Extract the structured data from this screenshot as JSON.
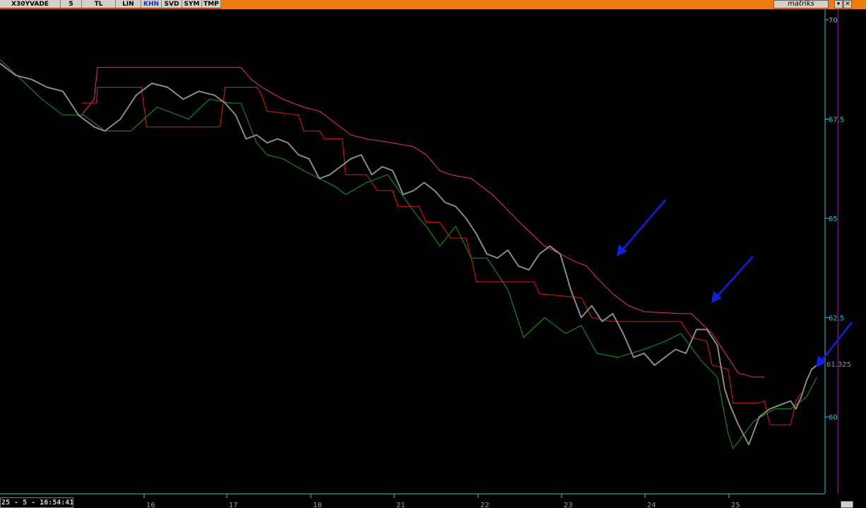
{
  "toolbar": {
    "symbol": "X30YVADE",
    "period": "5",
    "currency": "TL",
    "scale": "LIN",
    "khn": "KHN",
    "svd": "SVD",
    "sym": "SYM",
    "tmp": "TMP",
    "brand": "matriks",
    "dropdown_icon": "triangle-down",
    "close_icon": "cross"
  },
  "status": {
    "time": "25 - 5 - 16:54:41"
  },
  "colors": {
    "price": "#8a8a8a",
    "upper_band": "#e8307a",
    "middle_band": "#e01818",
    "lower_band": "#189a18",
    "cursor_line": "#a020a0",
    "arrows": "#1020e0",
    "axis": "#40c0d0"
  },
  "chart_data": {
    "type": "line",
    "title": "",
    "xlabel": "",
    "ylabel": "",
    "ylim": [
      58.0,
      70.3
    ],
    "yticks": [
      "70",
      "67.5",
      "65",
      "62.5",
      "60"
    ],
    "xticks": [
      "16",
      "17",
      "18",
      "21",
      "22",
      "23",
      "24",
      "25"
    ],
    "last_value_label": "61.325",
    "cursor_x": 23.0,
    "grid": false,
    "series": [
      {
        "key": "upper_band",
        "points": [
          [
            15.78,
            67.6
          ],
          [
            15.9,
            68.0
          ],
          [
            15.93,
            68.8
          ],
          [
            16.4,
            68.8
          ],
          [
            16.8,
            68.8
          ],
          [
            17.1,
            68.8
          ],
          [
            17.3,
            68.8
          ],
          [
            17.4,
            68.5
          ],
          [
            17.5,
            68.3
          ],
          [
            17.7,
            68.0
          ],
          [
            17.9,
            67.8
          ],
          [
            18.05,
            67.7
          ],
          [
            18.2,
            67.4
          ],
          [
            18.35,
            67.1
          ],
          [
            18.5,
            67.0
          ],
          [
            18.75,
            66.9
          ],
          [
            18.95,
            66.8
          ],
          [
            19.07,
            66.6
          ],
          [
            19.2,
            66.2
          ],
          [
            19.3,
            66.1
          ],
          [
            19.5,
            66.0
          ],
          [
            19.7,
            65.6
          ],
          [
            19.85,
            65.2
          ],
          [
            20.0,
            64.8
          ],
          [
            20.2,
            64.3
          ],
          [
            20.35,
            64.1
          ],
          [
            20.5,
            63.9
          ],
          [
            20.6,
            63.8
          ],
          [
            20.7,
            63.5
          ],
          [
            20.85,
            63.1
          ],
          [
            21.0,
            62.8
          ],
          [
            21.15,
            62.65
          ],
          [
            21.5,
            62.6
          ],
          [
            21.6,
            62.6
          ],
          [
            21.8,
            62.1
          ],
          [
            21.95,
            61.5
          ],
          [
            22.05,
            61.1
          ],
          [
            22.2,
            61.0
          ],
          [
            22.3,
            61.0
          ]
        ]
      },
      {
        "key": "middle_band",
        "points": [
          [
            15.78,
            67.9
          ],
          [
            15.92,
            67.9
          ],
          [
            15.93,
            68.3
          ],
          [
            16.25,
            68.3
          ],
          [
            16.35,
            68.3
          ],
          [
            16.4,
            67.3
          ],
          [
            16.8,
            67.3
          ],
          [
            17.1,
            67.3
          ],
          [
            17.15,
            68.3
          ],
          [
            17.45,
            68.3
          ],
          [
            17.5,
            68.1
          ],
          [
            17.55,
            67.7
          ],
          [
            17.85,
            67.6
          ],
          [
            17.9,
            67.2
          ],
          [
            18.05,
            67.2
          ],
          [
            18.1,
            67.0
          ],
          [
            18.27,
            67.0
          ],
          [
            18.3,
            66.1
          ],
          [
            18.5,
            66.1
          ],
          [
            18.6,
            65.7
          ],
          [
            18.75,
            65.7
          ],
          [
            18.8,
            65.3
          ],
          [
            19.0,
            65.3
          ],
          [
            19.07,
            64.9
          ],
          [
            19.2,
            64.9
          ],
          [
            19.3,
            64.5
          ],
          [
            19.45,
            64.5
          ],
          [
            19.5,
            64.0
          ],
          [
            19.55,
            63.4
          ],
          [
            20.1,
            63.4
          ],
          [
            20.15,
            63.1
          ],
          [
            20.55,
            63.0
          ],
          [
            20.65,
            62.5
          ],
          [
            20.85,
            62.4
          ],
          [
            21.1,
            62.4
          ],
          [
            21.5,
            62.4
          ],
          [
            21.6,
            62.0
          ],
          [
            21.75,
            61.9
          ],
          [
            21.8,
            61.3
          ],
          [
            21.95,
            61.2
          ],
          [
            22.0,
            60.35
          ],
          [
            22.25,
            60.35
          ],
          [
            22.3,
            60.4
          ],
          [
            22.35,
            59.8
          ],
          [
            22.55,
            59.8
          ],
          [
            22.6,
            60.4
          ],
          [
            22.65,
            60.6
          ]
        ]
      },
      {
        "key": "lower_band",
        "points": [
          [
            15.0,
            69.0
          ],
          [
            15.2,
            68.5
          ],
          [
            15.4,
            68.0
          ],
          [
            15.6,
            67.6
          ],
          [
            15.8,
            67.6
          ],
          [
            16.0,
            67.2
          ],
          [
            16.25,
            67.2
          ],
          [
            16.5,
            67.8
          ],
          [
            16.8,
            67.5
          ],
          [
            17.0,
            68.0
          ],
          [
            17.2,
            67.9
          ],
          [
            17.3,
            67.9
          ],
          [
            17.45,
            66.9
          ],
          [
            17.55,
            66.6
          ],
          [
            17.7,
            66.5
          ],
          [
            17.9,
            66.2
          ],
          [
            18.2,
            65.8
          ],
          [
            18.3,
            65.6
          ],
          [
            18.5,
            65.9
          ],
          [
            18.7,
            66.1
          ],
          [
            19.0,
            65.0
          ],
          [
            19.07,
            64.8
          ],
          [
            19.2,
            64.3
          ],
          [
            19.35,
            64.8
          ],
          [
            19.5,
            64.0
          ],
          [
            19.65,
            64.0
          ],
          [
            19.85,
            63.2
          ],
          [
            20.0,
            62.0
          ],
          [
            20.2,
            62.5
          ],
          [
            20.4,
            62.1
          ],
          [
            20.55,
            62.3
          ],
          [
            20.7,
            61.6
          ],
          [
            20.9,
            61.5
          ],
          [
            21.15,
            61.7
          ],
          [
            21.35,
            61.9
          ],
          [
            21.5,
            62.1
          ],
          [
            21.7,
            61.4
          ],
          [
            21.85,
            61.0
          ],
          [
            21.95,
            59.6
          ],
          [
            22.0,
            59.2
          ],
          [
            22.2,
            59.9
          ],
          [
            22.4,
            60.2
          ],
          [
            22.55,
            60.2
          ],
          [
            22.7,
            60.5
          ],
          [
            22.8,
            61.0
          ]
        ]
      },
      {
        "key": "price",
        "points": [
          [
            15.0,
            68.9
          ],
          [
            15.15,
            68.6
          ],
          [
            15.3,
            68.5
          ],
          [
            15.45,
            68.3
          ],
          [
            15.6,
            68.2
          ],
          [
            15.75,
            67.6
          ],
          [
            15.9,
            67.3
          ],
          [
            16.0,
            67.2
          ],
          [
            16.15,
            67.5
          ],
          [
            16.3,
            68.1
          ],
          [
            16.45,
            68.4
          ],
          [
            16.6,
            68.3
          ],
          [
            16.75,
            68.0
          ],
          [
            16.9,
            68.2
          ],
          [
            17.05,
            68.1
          ],
          [
            17.15,
            67.9
          ],
          [
            17.25,
            67.6
          ],
          [
            17.35,
            67.0
          ],
          [
            17.45,
            67.1
          ],
          [
            17.55,
            66.9
          ],
          [
            17.65,
            67.0
          ],
          [
            17.75,
            66.9
          ],
          [
            17.85,
            66.6
          ],
          [
            17.95,
            66.5
          ],
          [
            18.05,
            66.0
          ],
          [
            18.15,
            66.1
          ],
          [
            18.25,
            66.3
          ],
          [
            18.35,
            66.5
          ],
          [
            18.45,
            66.6
          ],
          [
            18.55,
            66.1
          ],
          [
            18.65,
            66.3
          ],
          [
            18.75,
            66.2
          ],
          [
            18.85,
            65.6
          ],
          [
            18.95,
            65.7
          ],
          [
            19.05,
            65.9
          ],
          [
            19.15,
            65.7
          ],
          [
            19.25,
            65.4
          ],
          [
            19.35,
            65.3
          ],
          [
            19.45,
            65.0
          ],
          [
            19.55,
            64.6
          ],
          [
            19.65,
            64.1
          ],
          [
            19.75,
            64.0
          ],
          [
            19.85,
            64.2
          ],
          [
            19.95,
            63.8
          ],
          [
            20.05,
            63.7
          ],
          [
            20.15,
            64.1
          ],
          [
            20.25,
            64.3
          ],
          [
            20.35,
            64.1
          ],
          [
            20.45,
            63.2
          ],
          [
            20.55,
            62.5
          ],
          [
            20.65,
            62.8
          ],
          [
            20.75,
            62.4
          ],
          [
            20.85,
            62.6
          ],
          [
            20.95,
            62.1
          ],
          [
            21.05,
            61.5
          ],
          [
            21.15,
            61.6
          ],
          [
            21.25,
            61.3
          ],
          [
            21.35,
            61.5
          ],
          [
            21.45,
            61.7
          ],
          [
            21.55,
            61.6
          ],
          [
            21.65,
            62.2
          ],
          [
            21.75,
            62.2
          ],
          [
            21.85,
            61.8
          ],
          [
            21.92,
            60.7
          ],
          [
            21.97,
            60.3
          ],
          [
            22.05,
            59.8
          ],
          [
            22.15,
            59.3
          ],
          [
            22.25,
            60.0
          ],
          [
            22.35,
            60.2
          ],
          [
            22.45,
            60.3
          ],
          [
            22.55,
            60.4
          ],
          [
            22.6,
            60.2
          ],
          [
            22.65,
            60.5
          ],
          [
            22.7,
            60.9
          ],
          [
            22.75,
            61.2
          ],
          [
            22.8,
            61.3
          ]
        ]
      }
    ]
  }
}
